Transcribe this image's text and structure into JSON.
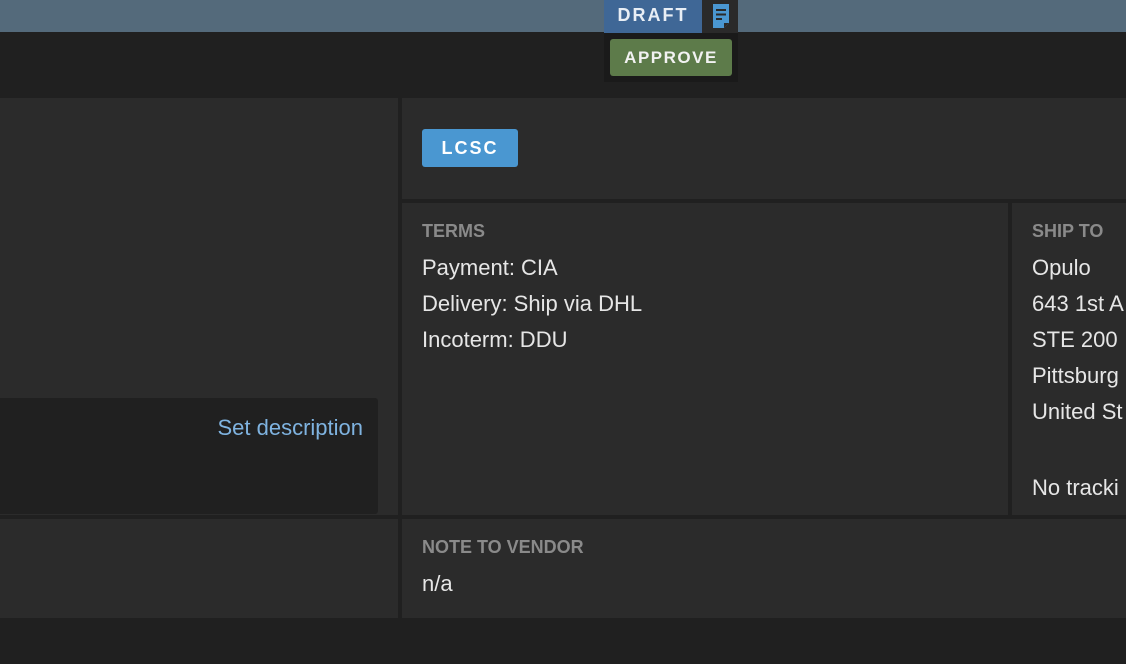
{
  "header": {
    "status_badge": "DRAFT",
    "doc_icon": "document-icon",
    "approve_label": "APPROVE"
  },
  "description": {
    "set_label": "Set description"
  },
  "vendor": {
    "name_badge": "LCSC"
  },
  "terms": {
    "label": "TERMS",
    "payment": "Payment: CIA",
    "delivery": "Delivery: Ship via DHL",
    "incoterm": "Incoterm: DDU"
  },
  "ship_to": {
    "label": "SHIP TO",
    "lines": [
      "Opulo",
      "643 1st A",
      "STE 200",
      "Pittsburg",
      "United St"
    ],
    "tracking": "No tracki"
  },
  "note": {
    "label": "NOTE TO VENDOR",
    "value": "n/a"
  },
  "colors": {
    "topbar": "#546a7b",
    "draft": "#3f6796",
    "approve": "#5d7b4a",
    "vendor_badge": "#4a97d1",
    "link": "#7fb3e0"
  }
}
